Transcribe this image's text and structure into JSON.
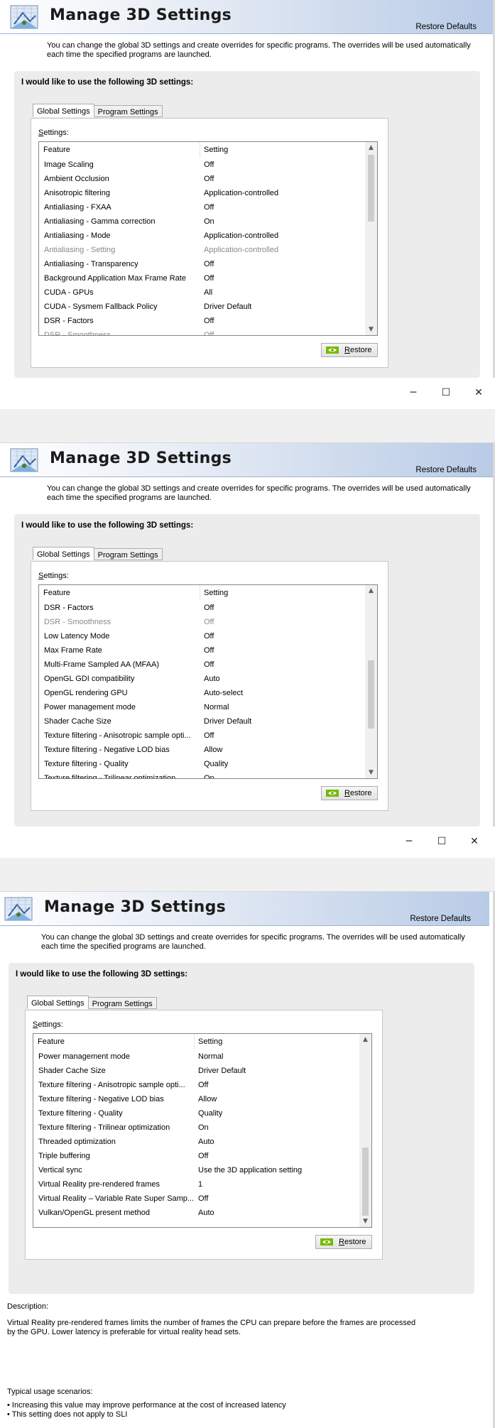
{
  "page": {
    "title": "Manage 3D Settings",
    "restore_defaults": "Restore Defaults",
    "intro": "You can change the global 3D settings and create overrides for specific programs. The overrides will be used automatically each time the specified programs are launched.",
    "group_title": "I would like to use the following 3D settings:",
    "tabs": [
      "Global Settings",
      "Program Settings"
    ],
    "settings_label_prefix": "S",
    "settings_label_rest": "ettings:",
    "col_feature": "Feature",
    "col_setting": "Setting",
    "restore_button_prefix": "R",
    "restore_button_rest": "estore"
  },
  "window_controls": {
    "minimize": "─",
    "maximize": "☐",
    "close": "✕"
  },
  "shot1_rows": [
    {
      "feature": "Image Scaling",
      "setting": "Off"
    },
    {
      "feature": "Ambient Occlusion",
      "setting": "Off"
    },
    {
      "feature": "Anisotropic filtering",
      "setting": "Application-controlled"
    },
    {
      "feature": "Antialiasing - FXAA",
      "setting": "Off"
    },
    {
      "feature": "Antialiasing - Gamma correction",
      "setting": "On"
    },
    {
      "feature": "Antialiasing - Mode",
      "setting": "Application-controlled"
    },
    {
      "feature": "Antialiasing - Setting",
      "setting": "Application-controlled",
      "dim": true
    },
    {
      "feature": "Antialiasing - Transparency",
      "setting": "Off"
    },
    {
      "feature": "Background Application Max Frame Rate",
      "setting": "Off"
    },
    {
      "feature": "CUDA - GPUs",
      "setting": "All"
    },
    {
      "feature": "CUDA - Sysmem Fallback Policy",
      "setting": "Driver Default"
    },
    {
      "feature": "DSR - Factors",
      "setting": "Off"
    },
    {
      "feature": "DSR - Smoothness",
      "setting": "Off",
      "dim": true
    }
  ],
  "shot2_rows": [
    {
      "feature": "DSR - Factors",
      "setting": "Off"
    },
    {
      "feature": "DSR - Smoothness",
      "setting": "Off",
      "dim": true
    },
    {
      "feature": "Low Latency Mode",
      "setting": "Off"
    },
    {
      "feature": "Max Frame Rate",
      "setting": "Off"
    },
    {
      "feature": "Multi-Frame Sampled AA (MFAA)",
      "setting": "Off"
    },
    {
      "feature": "OpenGL GDI compatibility",
      "setting": "Auto"
    },
    {
      "feature": "OpenGL rendering GPU",
      "setting": "Auto-select"
    },
    {
      "feature": "Power management mode",
      "setting": "Normal"
    },
    {
      "feature": "Shader Cache Size",
      "setting": "Driver Default"
    },
    {
      "feature": "Texture filtering - Anisotropic sample opti...",
      "setting": "Off"
    },
    {
      "feature": "Texture filtering - Negative LOD bias",
      "setting": "Allow"
    },
    {
      "feature": "Texture filtering - Quality",
      "setting": "Quality"
    },
    {
      "feature": "Texture filtering - Trilinear optimization",
      "setting": "On"
    }
  ],
  "shot3_rows": [
    {
      "feature": "Power management mode",
      "setting": "Normal"
    },
    {
      "feature": "Shader Cache Size",
      "setting": "Driver Default"
    },
    {
      "feature": "Texture filtering - Anisotropic sample opti...",
      "setting": "Off"
    },
    {
      "feature": "Texture filtering - Negative LOD bias",
      "setting": "Allow"
    },
    {
      "feature": "Texture filtering - Quality",
      "setting": "Quality"
    },
    {
      "feature": "Texture filtering - Trilinear optimization",
      "setting": "On"
    },
    {
      "feature": "Threaded optimization",
      "setting": "Auto"
    },
    {
      "feature": "Triple buffering",
      "setting": "Off"
    },
    {
      "feature": "Vertical sync",
      "setting": "Use the 3D application setting"
    },
    {
      "feature": "Virtual Reality pre-rendered frames",
      "setting": "1"
    },
    {
      "feature": "Virtual Reality – Variable Rate Super Samp...",
      "setting": "Off"
    },
    {
      "feature": "Vulkan/OpenGL present method",
      "setting": "Auto"
    }
  ],
  "description": {
    "heading": "Description:",
    "text_line1": "Virtual Reality pre-rendered frames limits the number of frames the CPU can prepare before the frames are processed",
    "text_line2": "by the GPU. Lower latency is preferable for virtual reality head sets.",
    "usage_heading": "Typical usage scenarios:",
    "usage": [
      "• Increasing this value may improve performance at the cost of increased latency",
      "• This setting does not apply to SLI"
    ]
  }
}
